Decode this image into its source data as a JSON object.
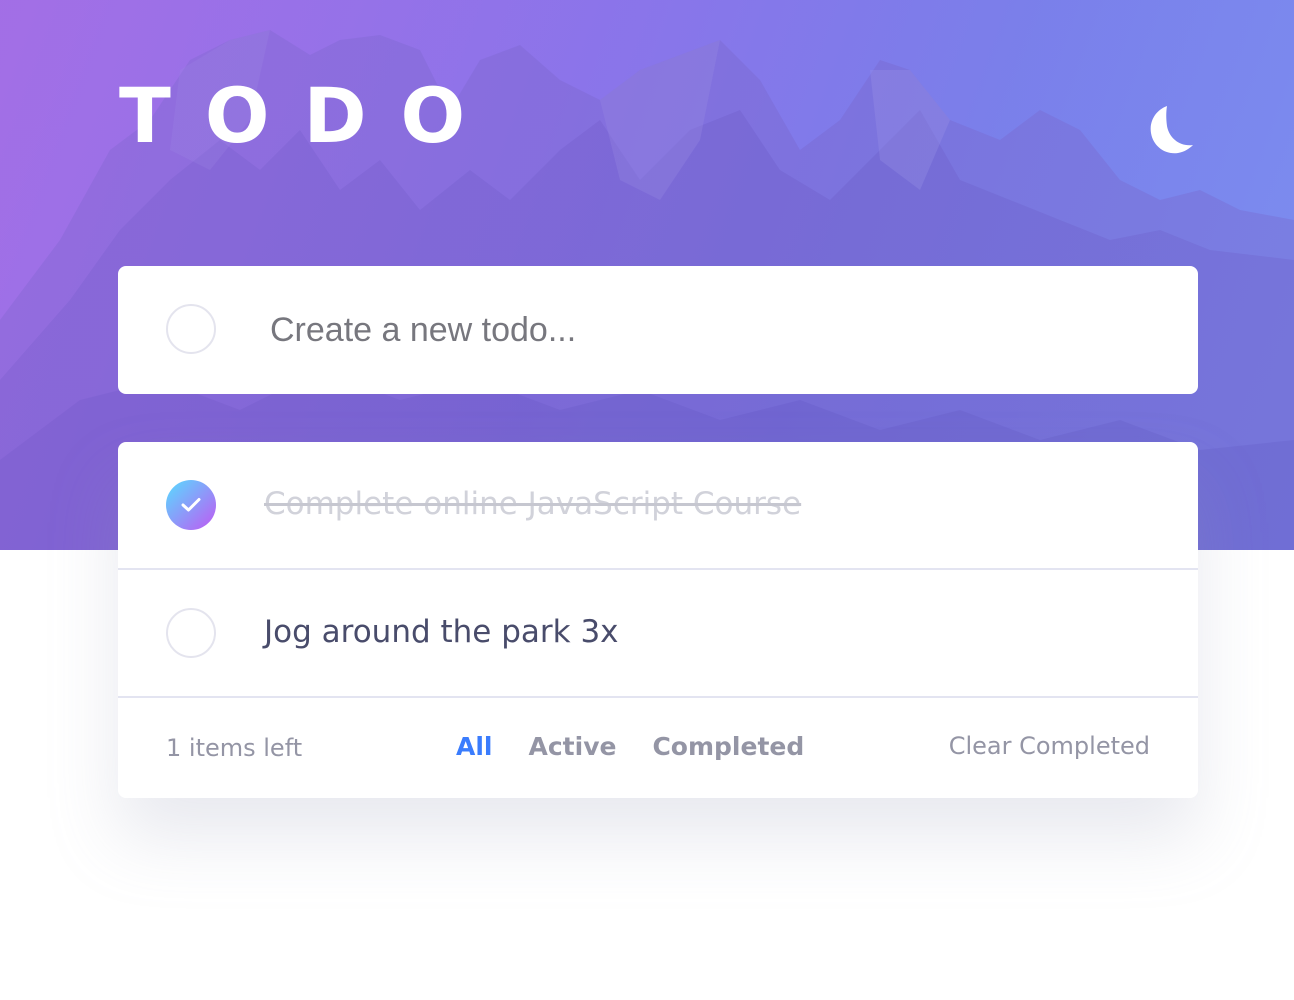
{
  "app": {
    "title": "TODO",
    "theme_toggle_icon": "moon-icon"
  },
  "new_todo": {
    "placeholder": "Create a new todo...",
    "value": ""
  },
  "todos": [
    {
      "text": "Complete online JavaScript Course",
      "completed": true
    },
    {
      "text": "Jog around the park 3x",
      "completed": false
    }
  ],
  "footer": {
    "items_left": "1 items left",
    "filters": [
      {
        "label": "All",
        "active": true
      },
      {
        "label": "Active",
        "active": false
      },
      {
        "label": "Completed",
        "active": false
      }
    ],
    "clear_label": "Clear Completed"
  },
  "colors": {
    "accent": "#3a7cfd",
    "check_gradient_start": "#57ddff",
    "check_gradient_end": "#c058f3",
    "text_primary": "#494c6b",
    "text_muted": "#9495a5",
    "text_completed": "#d1d2da",
    "hero_purple": "#a46fe6",
    "hero_blue": "#7d8ff0"
  }
}
